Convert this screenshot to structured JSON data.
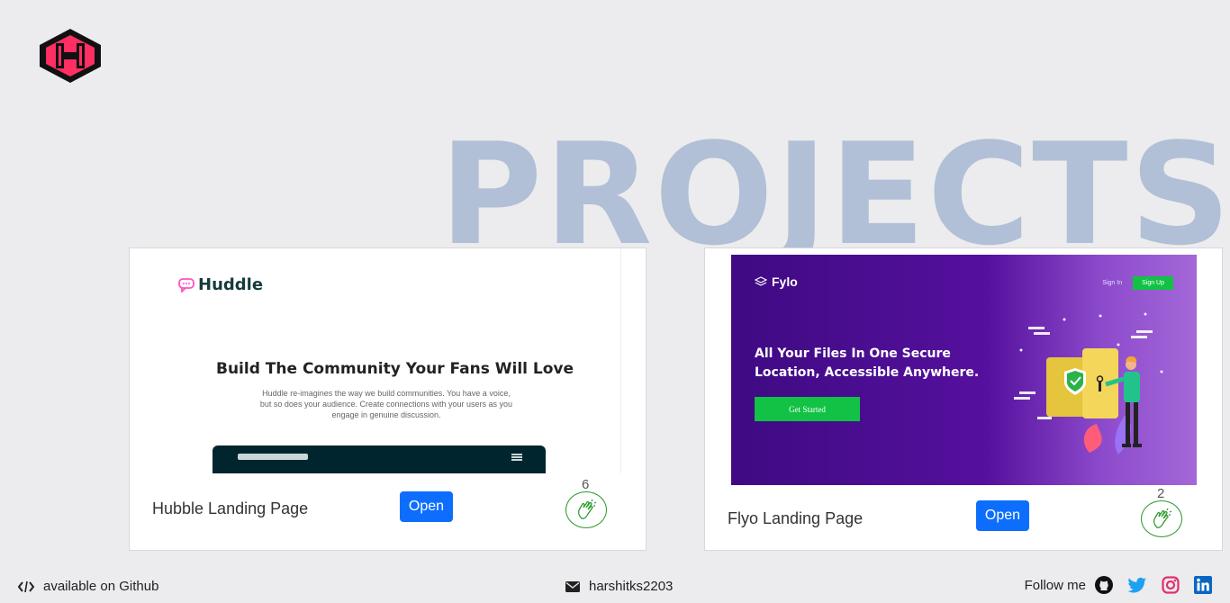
{
  "header": {
    "logo_icon": "hexagon-h-logo-icon"
  },
  "background_title": "PROJECTS",
  "projects": [
    {
      "title": "Hubble Landing Page",
      "open_label": "Open",
      "claps": "6",
      "preview": {
        "brand": "Huddle",
        "headline": "Build The Community Your Fans Will Love",
        "body": "Huddle re-imagines the way we build communities. You have a voice, but so does your audience. Create connections with your users as you engage in genuine discussion."
      }
    },
    {
      "title": "Flyo Landing Page",
      "open_label": "Open",
      "claps": "2",
      "preview": {
        "brand": "Fylo",
        "nav_signin": "Sign In",
        "nav_signup": "Sign Up",
        "headline": "All Your Files In One Secure Location, Accessible Anywhere.",
        "cta": "Get Started"
      }
    }
  ],
  "footer": {
    "github_text": "available on Github",
    "email_text": "harshitks2203",
    "follow_text": "Follow me",
    "social_icons": [
      "github-icon",
      "twitter-icon",
      "instagram-icon",
      "linkedin-icon"
    ]
  },
  "colors": {
    "background": "#ececee",
    "title_watermark": "#b1c0d6",
    "button": "#0d6efd",
    "clap": "#2e9a2e",
    "logo_pink": "#ff2e63"
  }
}
